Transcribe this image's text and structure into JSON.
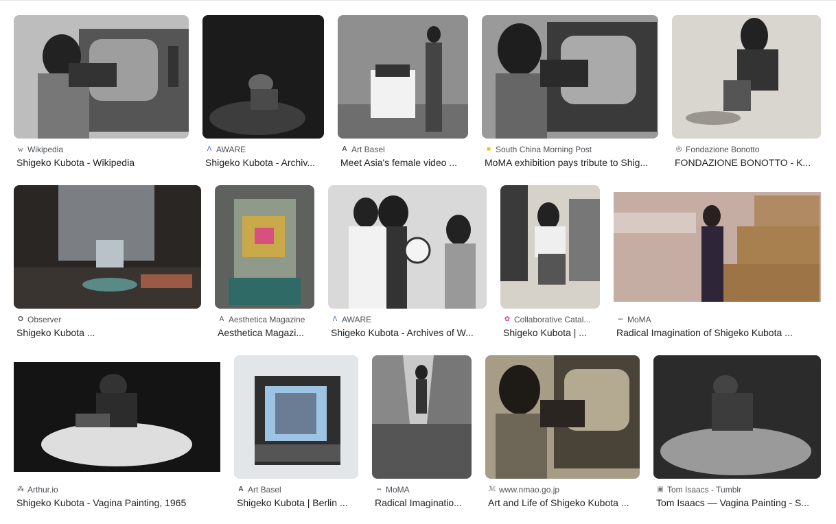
{
  "results": [
    {
      "source": "Wikipedia",
      "favicon": "wikipedia-icon",
      "title": "Shigeko Kubota - Wikipedia"
    },
    {
      "source": "AWARE",
      "favicon": "aware-icon",
      "title": "Shigeko Kubota - Archiv..."
    },
    {
      "source": "Art Basel",
      "favicon": "art-basel-icon",
      "title": "Meet Asia's female video ..."
    },
    {
      "source": "South China Morning Post",
      "favicon": "scmp-icon",
      "title": "MoMA exhibition pays tribute to Shig..."
    },
    {
      "source": "Fondazione Bonotto",
      "favicon": "bonotto-icon",
      "title": "FONDAZIONE BONOTTO - K..."
    },
    {
      "source": "Observer",
      "favicon": "observer-icon",
      "title": "Shigeko Kubota ..."
    },
    {
      "source": "Aesthetica Magazine",
      "favicon": "aesthetica-icon",
      "title": "Aesthetica Magazi..."
    },
    {
      "source": "AWARE",
      "favicon": "aware-icon",
      "title": "Shigeko Kubota - Archives of W..."
    },
    {
      "source": "Collaborative Catal...",
      "favicon": "collaborative-catalog-icon",
      "title": "Shigeko Kubota | ..."
    },
    {
      "source": "MoMA",
      "favicon": "moma-icon",
      "title": "Radical Imagination of Shigeko Kubota ..."
    },
    {
      "source": "Arthur.io",
      "favicon": "arthur-icon",
      "title": "Shigeko Kubota - Vagina Painting, 1965"
    },
    {
      "source": "Art Basel",
      "favicon": "art-basel-icon",
      "title": "Shigeko Kubota | Berlin ..."
    },
    {
      "source": "MoMA",
      "favicon": "moma-icon",
      "title": "Radical Imaginatio..."
    },
    {
      "source": "www.nmao.go.jp",
      "favicon": "nmao-icon",
      "title": "Art and Life of Shigeko Kubota ..."
    },
    {
      "source": "Tom Isaacs - Tumblr",
      "favicon": "tumblr-icon",
      "title": "Tom Isaacs — Vagina Painting - S..."
    }
  ],
  "favicon_glyphs": {
    "wikipedia-icon": "w",
    "aware-icon": "Λ",
    "art-basel-icon": "A",
    "scmp-icon": "■",
    "bonotto-icon": "◎",
    "observer-icon": "O",
    "aesthetica-icon": "A",
    "collaborative-catalog-icon": "✿",
    "moma-icon": "▪▪▪",
    "arthur-icon": "⁂",
    "nmao-icon": "ℳ",
    "tumblr-icon": "▣"
  },
  "colors": {
    "scmp": "#f5c400",
    "collaborative": "#d63bbd",
    "aware": "#3a5cd8",
    "text": "#202124",
    "meta": "#4d5156"
  }
}
